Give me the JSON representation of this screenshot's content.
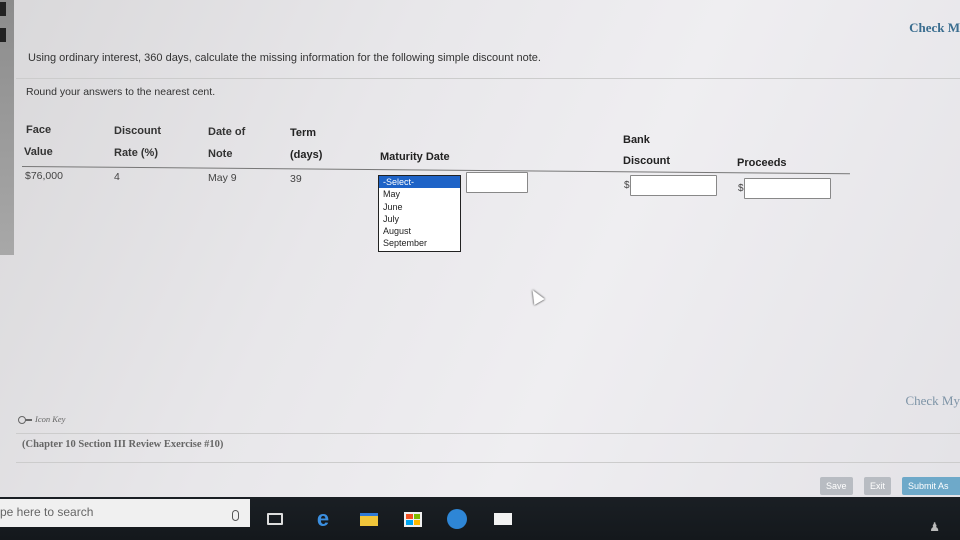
{
  "header": {
    "check_link_top": "Check M",
    "check_link_bottom": "Check My"
  },
  "instructions": {
    "main": "Using ordinary interest, 360 days, calculate the missing information for the following simple discount note.",
    "round": "Round your answers to the nearest cent."
  },
  "table": {
    "headers": {
      "face_1": "Face",
      "face_2": "Value",
      "discount_1": "Discount",
      "discount_2": "Rate (%)",
      "date_1": "Date of",
      "date_2": "Note",
      "term_1": "Term",
      "term_2": "(days)",
      "maturity": "Maturity Date",
      "bank_1": "Bank",
      "bank_2": "Discount",
      "proceeds": "Proceeds"
    },
    "row": {
      "face_value": "$76,000",
      "discount_rate": "4",
      "date_of_note": "May 9",
      "term": "39",
      "bank_discount_prefix": "$",
      "proceeds_prefix": "$"
    }
  },
  "maturity_dropdown": {
    "options": [
      "-Select-",
      "May",
      "June",
      "July",
      "August",
      "September"
    ],
    "selected": "-Select-"
  },
  "footer": {
    "icon_key": "Icon Key",
    "chapter": "(Chapter 10 Section III Review Exercise #10)",
    "save": "Save",
    "exit": "Exit",
    "submit": "Submit As"
  },
  "taskbar": {
    "search_placeholder": "pe here to search"
  },
  "colors": {
    "accent_select": "#1e63c7",
    "submit_button": "#6ea9c9",
    "link": "#3a6d8f"
  }
}
